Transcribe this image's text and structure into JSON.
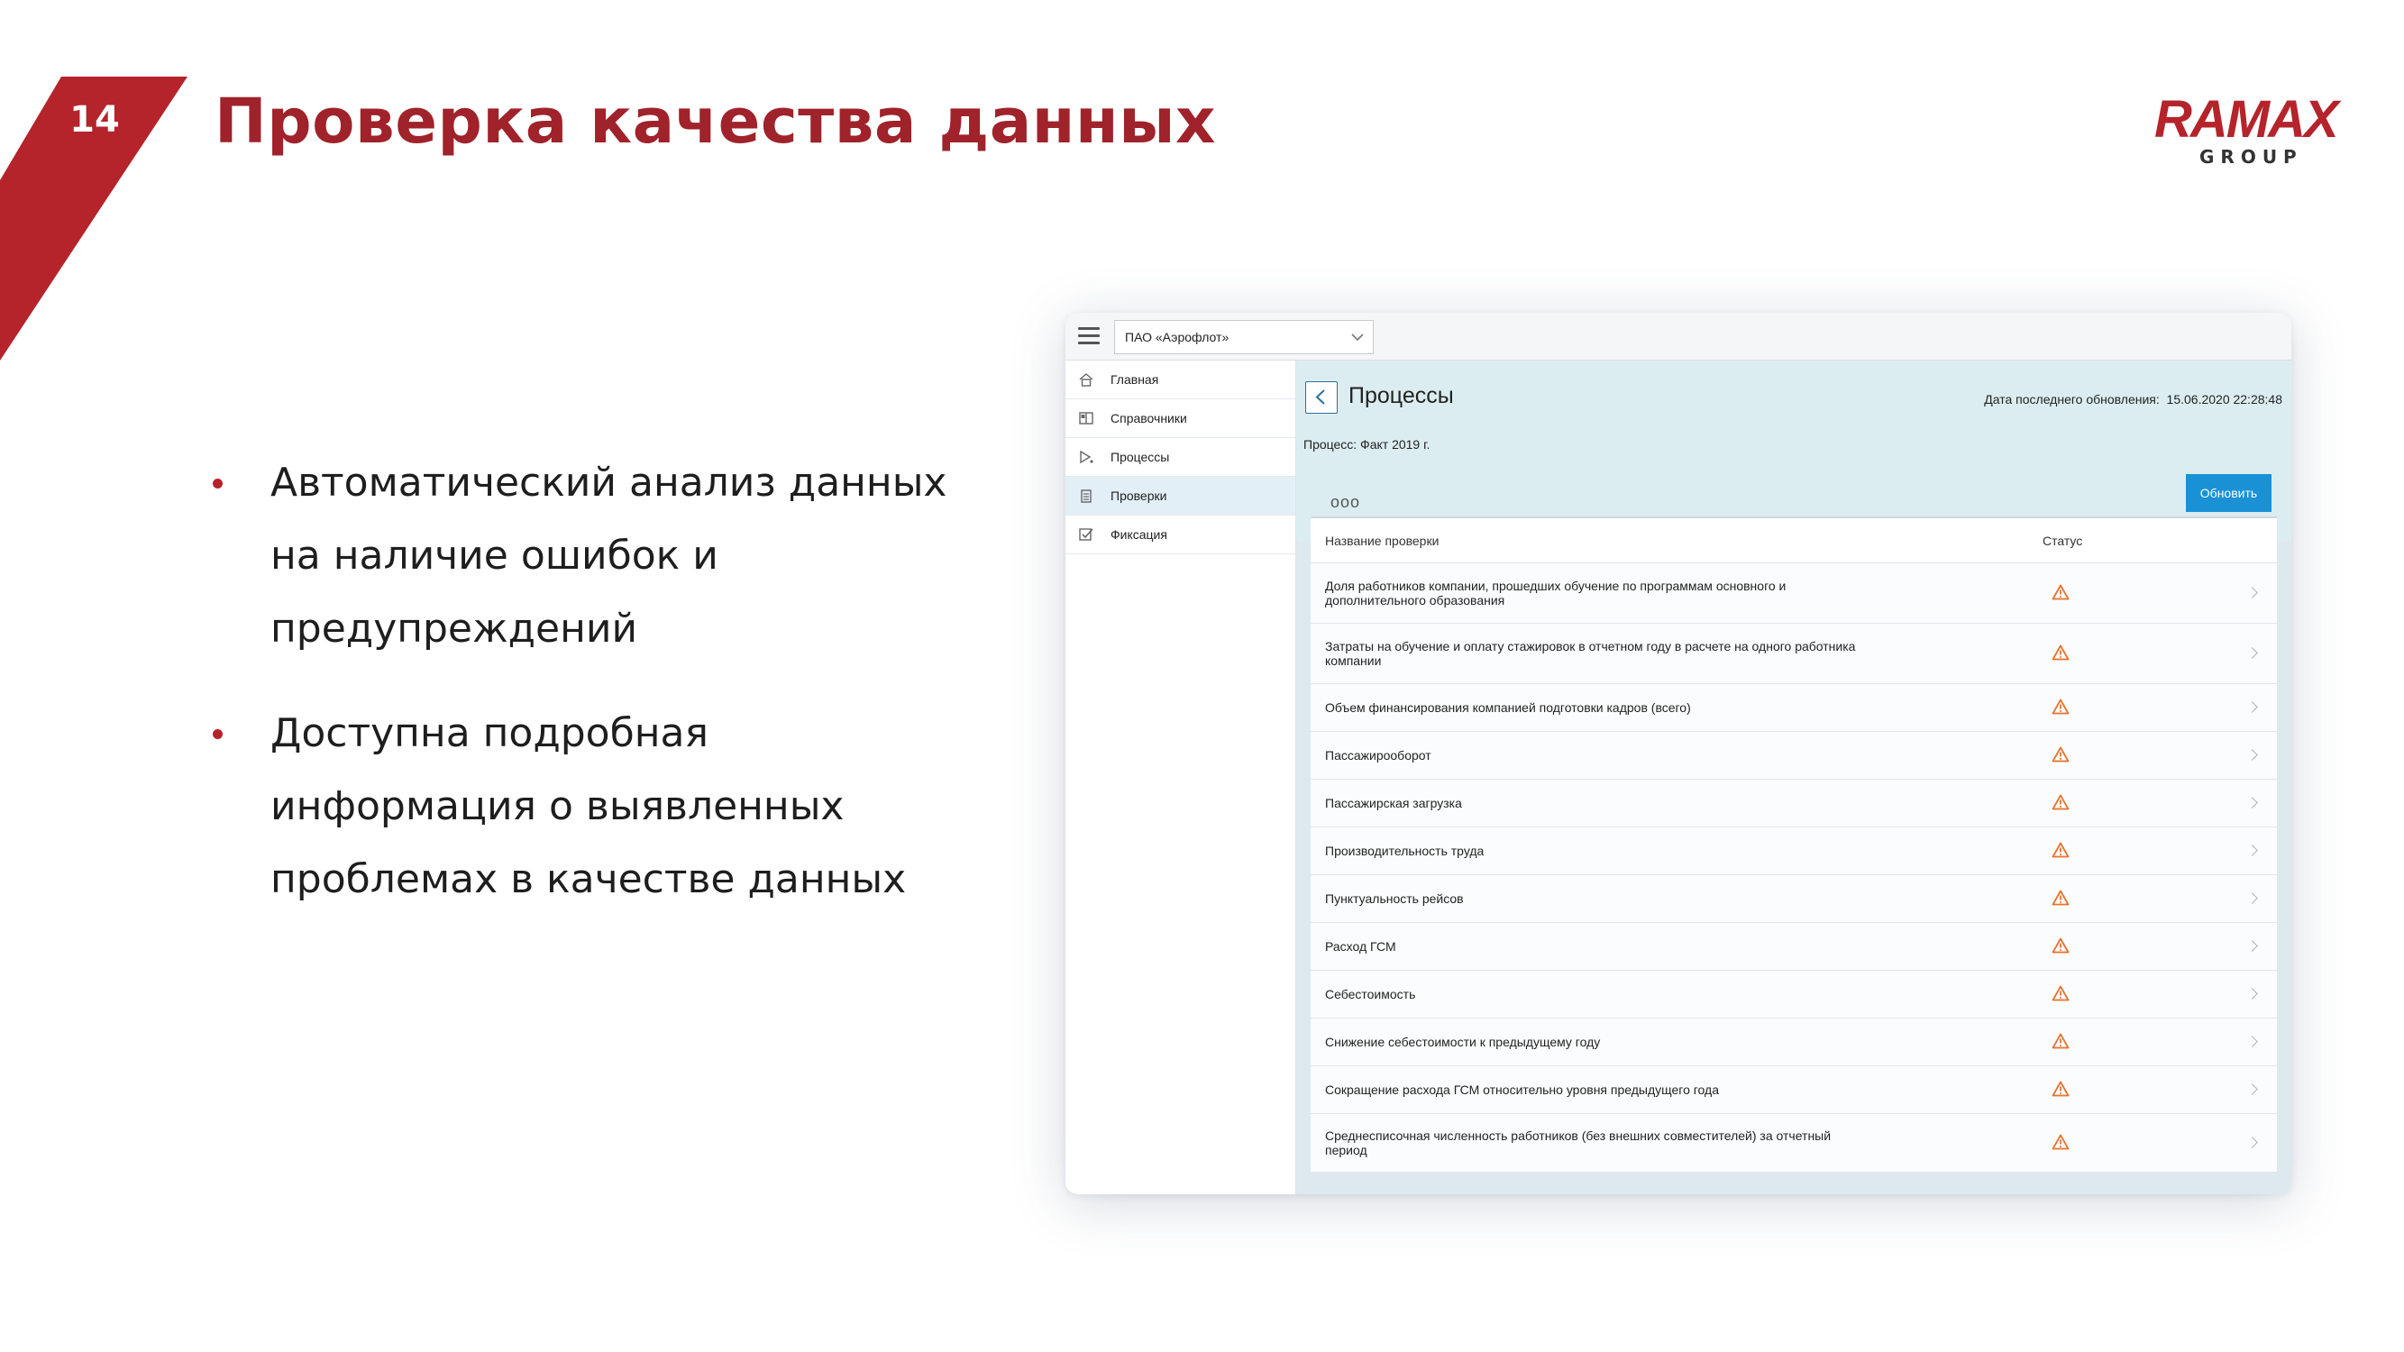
{
  "slide": {
    "number": "14",
    "title": "Проверка качества данных",
    "logo": {
      "main": "RAMAX",
      "sub": "GROUP"
    },
    "bullets": [
      "Автоматический анализ данных на наличие ошибок и предупреждений",
      "Доступна подробная информация о выявленных проблемах в качестве данных"
    ],
    "accent_color": "#a0222a"
  },
  "app": {
    "org_select": "ПАО «Аэрофлот»",
    "sidebar": {
      "items": [
        {
          "label": "Главная",
          "icon": "home-icon"
        },
        {
          "label": "Справочники",
          "icon": "book-icon"
        },
        {
          "label": "Процессы",
          "icon": "process-icon"
        },
        {
          "label": "Проверки",
          "icon": "clipboard-icon"
        },
        {
          "label": "Фиксация",
          "icon": "checkbox-icon"
        }
      ],
      "active_index": 3
    },
    "header": {
      "title": "Процессы",
      "update_label": "Дата последнего обновления:",
      "update_value": "15.06.2020 22:28:48",
      "process_label": "Процесс: Факт 2019 г.",
      "more": "ooo",
      "refresh_button": "Обновить"
    },
    "table": {
      "columns": [
        "Название проверки",
        "Статус"
      ],
      "rows": [
        {
          "name": "Доля работников компании, прошедших обучение по программам основного и дополнительного образования",
          "status": "warning"
        },
        {
          "name": "Затраты на обучение и оплату стажировок в отчетном году в расчете на одного работника компании",
          "status": "warning"
        },
        {
          "name": "Объем финансирования компанией подготовки кадров (всего)",
          "status": "warning"
        },
        {
          "name": "Пассажирооборот",
          "status": "warning"
        },
        {
          "name": "Пассажирская загрузка",
          "status": "warning"
        },
        {
          "name": "Производительность труда",
          "status": "warning"
        },
        {
          "name": "Пунктуальность рейсов",
          "status": "warning"
        },
        {
          "name": "Расход ГСМ",
          "status": "warning"
        },
        {
          "name": "Себестоимость",
          "status": "warning"
        },
        {
          "name": "Снижение себестоимости к предыдущему году",
          "status": "warning"
        },
        {
          "name": "Сокращение расхода ГСМ относительно уровня предыдущего года",
          "status": "warning"
        },
        {
          "name": "Среднесписочная численность работников (без внешних совместителей) за отчетный период",
          "status": "warning"
        }
      ],
      "warning_color": "#e8722c"
    }
  }
}
